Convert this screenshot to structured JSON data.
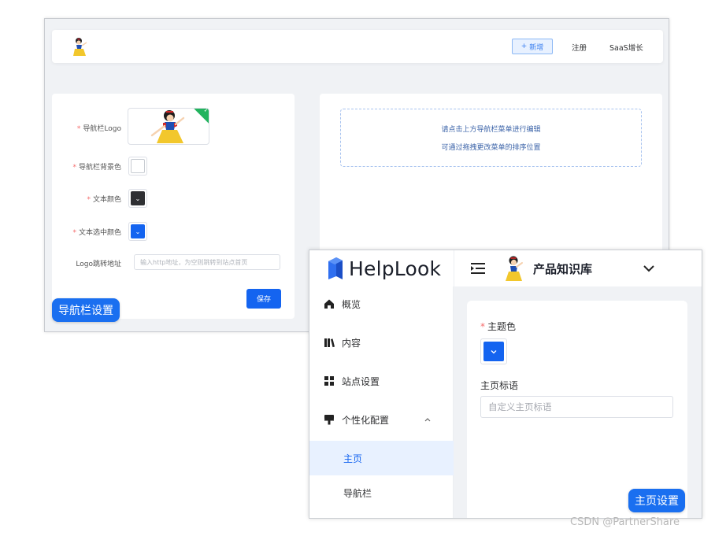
{
  "colors": {
    "primary": "#1464f0",
    "badge": "#1a6ff0",
    "nav_text_color": "#2f3033",
    "nav_bg_color": "#ffffff",
    "selected_text_color": "#1464f0"
  },
  "nav_settings": {
    "preview": {
      "add_label": "新增",
      "links": [
        "注册",
        "SaaS增长"
      ]
    },
    "form": {
      "logo_label": "导航栏Logo",
      "bg_color_label": "导航栏背景色",
      "text_color_label": "文本颜色",
      "selected_text_color_label": "文本选中颜色",
      "logo_url_label": "Logo跳转地址",
      "logo_url_placeholder": "输入http地址，为空则跳转到站点首页",
      "save_label": "保存"
    },
    "hint_lines": [
      "请点击上方导航栏菜单进行编辑",
      "可通过拖拽更改菜单的排序位置"
    ],
    "badge": "导航栏设置"
  },
  "home_settings": {
    "brand": "HelpLook",
    "kb_title": "产品知识库",
    "sidebar": {
      "items": [
        "概览",
        "内容",
        "站点设置",
        "个性化配置"
      ],
      "sub_items": [
        "主页",
        "导航栏"
      ]
    },
    "form": {
      "theme_color_label": "主题色",
      "slogan_label": "主页标语",
      "slogan_placeholder": "自定义主页标语"
    },
    "badge": "主页设置"
  },
  "watermark": "CSDN @PartnerShare"
}
